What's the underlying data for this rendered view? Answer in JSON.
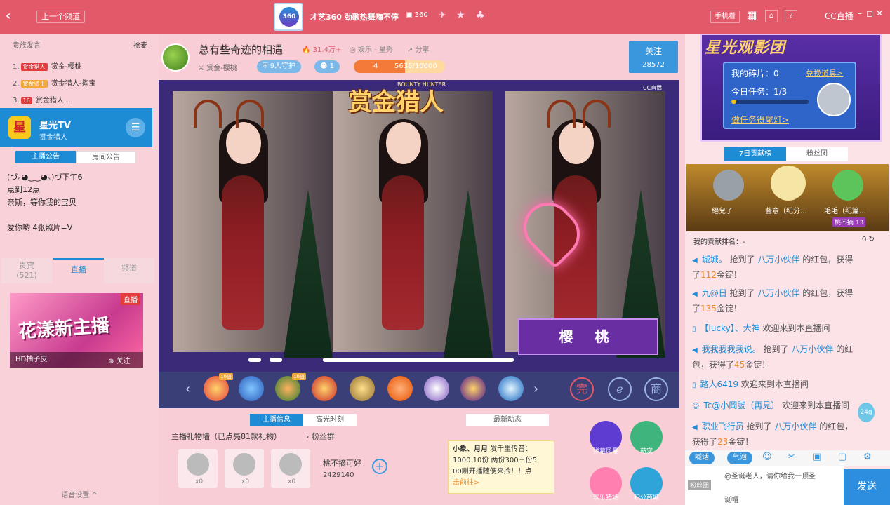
{
  "topbar": {
    "back": "‹",
    "prev_label": "上一个频道",
    "logo_text": "360",
    "title": "才艺360 劲歌热舞嗨不停",
    "room_id": "360",
    "phone_label": "手机看",
    "cc_label": "CC直播",
    "win_controls": [
      "–",
      "◻",
      "✕"
    ]
  },
  "left": {
    "rank_header": "贵族发言",
    "rank_right": "抢麦",
    "rank_rows": [
      {
        "num": "1.",
        "name": "赏金-樱桃",
        "tag": "赏金猎人"
      },
      {
        "num": "2.",
        "name": "赏金猎人-掏宝",
        "tag": "赏金骑士"
      },
      {
        "num": "3.",
        "name": "赏金猎人...",
        "tag": "16"
      }
    ],
    "tv": {
      "icon": "星",
      "name": "星光TV",
      "sub": "赏金猎人"
    },
    "announce_tabs": [
      "主播公告",
      "房间公告"
    ],
    "announce_lines": [
      "(づ｡◕‿‿◕｡)づ下午6",
      "点到12点",
      "亲斯，等你我的宝贝",
      "",
      "爱你哟  4张照片=V"
    ],
    "list_tabs": [
      {
        "label": "贵宾",
        "count": "(521)"
      },
      {
        "label": "直播",
        "count": ""
      },
      {
        "label": "频道",
        "count": ""
      }
    ],
    "promo": {
      "big": "花漾新主播",
      "live": "直播",
      "name": "HD柚子皮",
      "follow": "关注"
    },
    "voice": "语音设置 ^"
  },
  "center": {
    "room_title": "总有些奇迹的相遇",
    "heat": "31.4万+",
    "category": "娱乐 - 星秀",
    "share": "分享",
    "level_text": "赏金-樱桃",
    "guards": "9人守护",
    "fans": "1",
    "xp_level": "4",
    "xp_current": "5636",
    "xp_total": "/10000",
    "xp_fraction": 0.5636,
    "follow_label": "关注",
    "follow_count": "28572",
    "video_title": "赏金猎人",
    "video_sub": "BOUNTY HUNTER",
    "watermark": "CC直播",
    "nameplate": "樱 桃",
    "gift_tags": [
      "10倍",
      "",
      "10倍",
      "",
      "",
      "",
      "",
      "",
      ""
    ],
    "gift_icons_right": [
      "完",
      "ℯ",
      "商"
    ],
    "bottom_tabs": [
      "主播信息",
      "高光时刻"
    ],
    "news_tab": "最新动态",
    "giftwall_label": "主播礼物墙（已点亮81款礼物）",
    "fans_group": "粉丝群",
    "wall_counts": [
      "x0",
      "x0",
      "x0"
    ],
    "candidate_name": "桃不摘可好",
    "candidate_num": "2429140",
    "notice": {
      "title": "小象、月月",
      "line1": "发千里传音：",
      "line2": "1000  10份  两份300三份5",
      "line3": "00刚开播随便来捡！！点",
      "link": "击前往>"
    },
    "side_icons": [
      {
        "label": "弹幕风暴",
        "color": "#5e3bd1"
      },
      {
        "label": "萌宠",
        "color": "#3fb57d"
      },
      {
        "label": "欢乐猪场",
        "color": "#ff7fb1"
      },
      {
        "label": "积分商城",
        "color": "#2fa4d8"
      }
    ]
  },
  "right": {
    "banner_title": "星光观影团",
    "fragments": "我的碎片：0",
    "exchange": "兑换道具>",
    "task": "今日任务：1/3",
    "task_fraction": 0.3333,
    "task_link": "做任务得尾灯>",
    "tabs": [
      "7日贡献榜",
      "粉丝团"
    ],
    "podium": [
      {
        "name": "絕兒了",
        "color": "#9aa0a8"
      },
      {
        "name": "酱意（纪分...",
        "color": "#f5e6a6"
      },
      {
        "name": "毛毛（纪篇...",
        "color": "#5cc45a"
      }
    ],
    "badge": "桃不摘 13",
    "my_rank": "我的贡献排名：-",
    "my_rank_val": "0",
    "chat": [
      {
        "icon": "◀",
        "user": "城城。",
        "text1": " 抢到了 ",
        "link": "八万小伙伴",
        "text2": " 的红包，获得",
        "text3": "了",
        "amt": "112",
        "text4": "金锭！"
      },
      {
        "icon": "◀",
        "user": "九@日",
        "text1": " 抢到了 ",
        "link": "八万小伙伴",
        "text2": " 的红包，获得",
        "text3": "了",
        "amt": "135",
        "text4": "金锭！"
      },
      {
        "icon": "▯",
        "user": "【lucky】、大神",
        "text1": " 欢迎来到本直播间",
        "link": "",
        "text2": "",
        "text3": "",
        "amt": "",
        "text4": ""
      },
      {
        "icon": "◀",
        "user": "我我我我我说。",
        "text1": " 抢到了 ",
        "link": "八万小伙伴",
        "text2": " 的红",
        "text3": "包，获得了",
        "amt": "45",
        "text4": "金锭！"
      },
      {
        "icon": "▯",
        "user": "路人6419",
        "text1": " 欢迎来到本直播间",
        "link": "",
        "text2": "",
        "text3": "",
        "amt": "",
        "text4": ""
      },
      {
        "icon": "☺",
        "user": "Tc@小岡號（再見）",
        "text1": " 欢迎来到本直播间",
        "link": "",
        "text2": "",
        "text3": "",
        "amt": "",
        "text4": ""
      },
      {
        "icon": "◀",
        "user": "职业飞行员",
        "text1": " 抢到了 ",
        "link": "八万小伙伴",
        "text2": " 的红包，",
        "text3": "获得了",
        "amt": "23",
        "text4": "金锭！"
      }
    ],
    "chat_btn1": "喊话",
    "chat_btn2": "气泡",
    "input_tag": "粉丝团",
    "input_text": "@圣诞老人，请你给我一顶圣",
    "input_text2": "诞帽！",
    "send": "发送",
    "snow_badge": "24g"
  }
}
